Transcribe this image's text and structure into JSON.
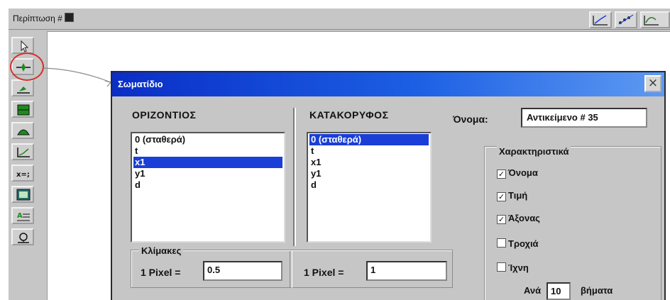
{
  "app": {
    "title": "Περίπτωση #",
    "toolbar_right": [
      "graph-tool-icon",
      "trajectory-tool-icon",
      "chart-tool-icon"
    ],
    "tools": [
      "arrow-pointer-icon",
      "particle-icon",
      "rotate-object-icon",
      "block-icon",
      "pulley-icon",
      "graph-icon",
      "variable-icon",
      "meter-icon",
      "text-icon",
      "magnifier-icon"
    ]
  },
  "dialog": {
    "title": "Σωματίδιο",
    "close_symbol": "×",
    "horizontal": {
      "header": "ΟΡΙΖΟΝΤΙΟΣ",
      "items": [
        "0 (σταθερά)",
        "t",
        "x1",
        "y1",
        "d"
      ],
      "selected_index": 2
    },
    "vertical": {
      "header": "ΚΑΤΑΚΟΡΥΦΟΣ",
      "items": [
        "0 (σταθερά)",
        "t",
        "x1",
        "y1",
        "d"
      ],
      "selected_index": 0
    },
    "name_label": "Όνομα:",
    "name_value": "Αντικείμενο # 35",
    "characteristics": {
      "title": "Χαρακτηριστικά",
      "options": [
        {
          "label": "Όνομα",
          "checked": true
        },
        {
          "label": "Τιμή",
          "checked": true
        },
        {
          "label": "Άξονας",
          "checked": true
        },
        {
          "label": "Τροχιά",
          "checked": false
        },
        {
          "label": "Ίχνη",
          "checked": false
        }
      ],
      "every_label": "Ανά",
      "every_value": "10",
      "steps_label": "βήματα"
    },
    "scales": {
      "title": "Κλίμακες",
      "horizontal_label": "1 Pixel =",
      "horizontal_value": "0.5",
      "vertical_label": "1 Pixel =",
      "vertical_value": "1"
    }
  },
  "colors": {
    "titlebar_start": "#0a2ec6",
    "titlebar_end": "#5e9af2",
    "selection": "#1a3fd6",
    "annotation": "#d0342c",
    "window_gray": "#c6c6c6"
  }
}
